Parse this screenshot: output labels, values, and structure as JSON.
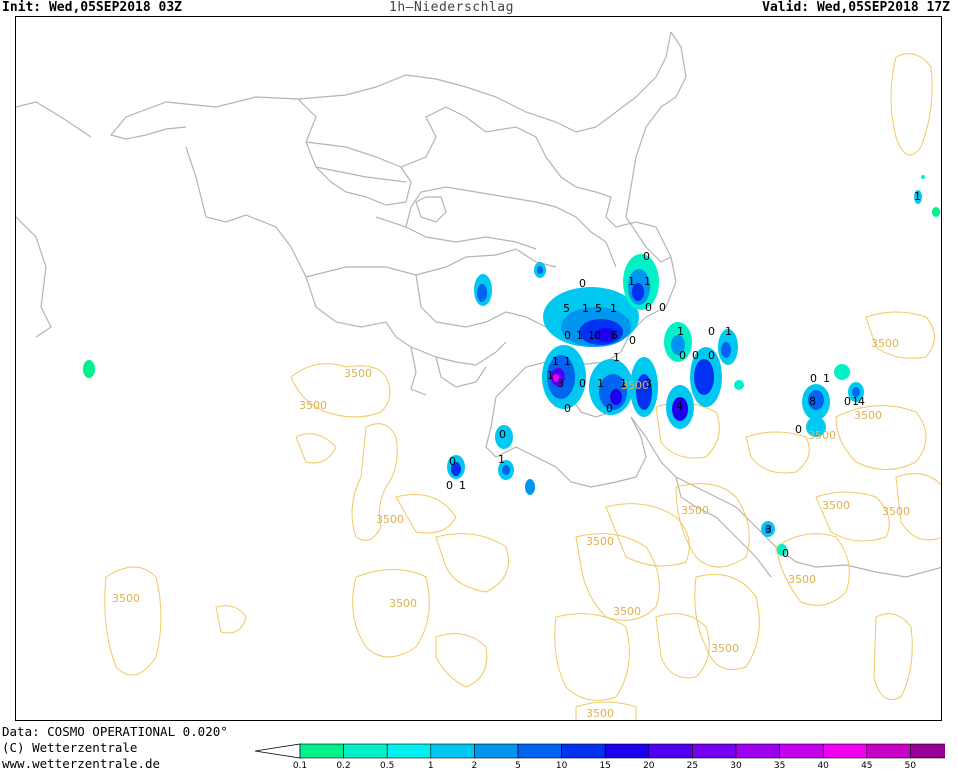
{
  "header": {
    "init": "Init: Wed,05SEP2018 03Z",
    "title": "1h—Niederschlag",
    "valid": "Valid: Wed,05SEP2018 17Z"
  },
  "footer": {
    "data_line": "Data: COSMO OPERATIONAL 0.020°",
    "copyright": "(C) Wetterzentrale",
    "url": "www.wetterzentrale.de"
  },
  "legend": {
    "ticks": [
      "0.1",
      "0.2",
      "0.5",
      "1",
      "2",
      "5",
      "10",
      "15",
      "20",
      "25",
      "30",
      "35",
      "40",
      "45",
      "50"
    ],
    "colors": [
      "#00f08c",
      "#00f0c8",
      "#00f0f0",
      "#00c8f0",
      "#0096f0",
      "#0064f0",
      "#0032f0",
      "#1e00f0",
      "#5000f0",
      "#7800f0",
      "#a000f0",
      "#c800f0",
      "#f000f0",
      "#c800c8",
      "#960096",
      "#640064"
    ]
  },
  "map": {
    "contour_labels": [
      "3500",
      "3500",
      "3500",
      "3500",
      "3500",
      "3500",
      "3500",
      "3500",
      "3500",
      "3500",
      "3500",
      "3500",
      "3500",
      "3500",
      "3500",
      "3500",
      "3500"
    ],
    "precip_labels": [
      "0",
      "1",
      "1",
      "5",
      "1",
      "5",
      "1",
      "0",
      "0",
      "0",
      "0",
      "1",
      "1",
      "1",
      "0",
      "1",
      "1",
      "1",
      "3",
      "0",
      "1",
      "1",
      "6",
      "0",
      "0",
      "0",
      "4",
      "0",
      "0",
      "1",
      "0",
      "3",
      "0",
      "1",
      "0",
      "1",
      "0",
      "1",
      "0",
      "0",
      "4",
      "3",
      "0",
      "8",
      "0",
      "1",
      "0",
      "1",
      "1"
    ]
  }
}
